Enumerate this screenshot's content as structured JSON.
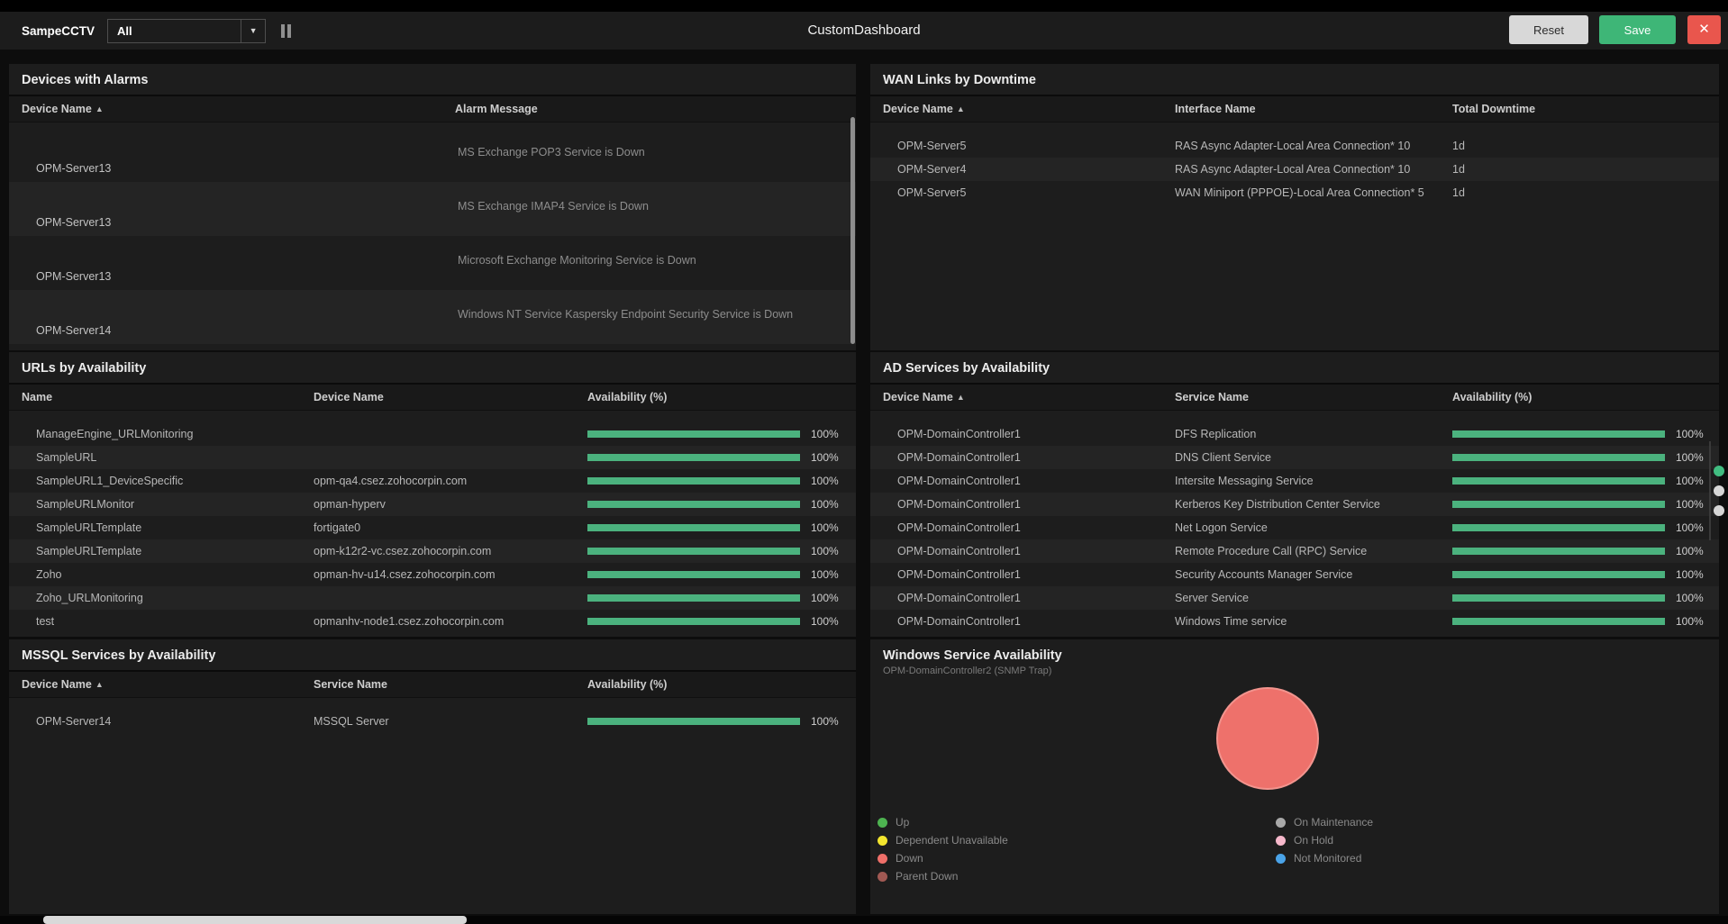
{
  "topbar": {
    "dashboard_name": "SampeCCTV",
    "filter_value": "All",
    "title": "CustomDashboard",
    "reset_label": "Reset",
    "save_label": "Save"
  },
  "icons": {
    "close": "✕",
    "dropdown_arrow": "▼",
    "sort_asc": "▲",
    "pause": "pause-icon"
  },
  "colors": {
    "availability_bar": "#4bb27e",
    "save_button": "#3eb677",
    "close_button": "#e9564d",
    "reset_button": "#d8d8d8",
    "pie_down": "#ee716b",
    "page_dot_active": "#41bd81",
    "page_dot_inactive": "#d6d6d6"
  },
  "panels": {
    "devices_with_alarms": {
      "title": "Devices with Alarms",
      "columns": [
        "Device Name",
        "Alarm Message"
      ],
      "rows": [
        {
          "device": "OPM-Server13",
          "message": "MS Exchange POP3 Service is Down"
        },
        {
          "device": "OPM-Server13",
          "message": "MS Exchange IMAP4 Service is Down"
        },
        {
          "device": "OPM-Server13",
          "message": "Microsoft Exchange Monitoring Service is Down"
        },
        {
          "device": "OPM-Server14",
          "message": "Windows NT Service Kaspersky Endpoint Security Service is Down"
        }
      ]
    },
    "wan_links": {
      "title": "WAN Links by Downtime",
      "columns": [
        "Device Name",
        "Interface Name",
        "Total Downtime"
      ],
      "rows": [
        {
          "device": "OPM-Server5",
          "interface": "RAS Async Adapter-Local Area Connection* 10",
          "downtime": "1d"
        },
        {
          "device": "OPM-Server4",
          "interface": "RAS Async Adapter-Local Area Connection* 10",
          "downtime": "1d"
        },
        {
          "device": "OPM-Server5",
          "interface": "WAN Miniport (PPPOE)-Local Area Connection* 5",
          "downtime": "1d"
        }
      ]
    },
    "urls": {
      "title": "URLs by Availability",
      "columns": [
        "Name",
        "Device Name",
        "Availability (%)"
      ],
      "rows": [
        {
          "name": "ManageEngine_URLMonitoring",
          "device": "",
          "availability": "100%"
        },
        {
          "name": "SampleURL",
          "device": "",
          "availability": "100%"
        },
        {
          "name": "SampleURL1_DeviceSpecific",
          "device": "opm-qa4.csez.zohocorpin.com",
          "availability": "100%"
        },
        {
          "name": "SampleURLMonitor",
          "device": "opman-hyperv",
          "availability": "100%"
        },
        {
          "name": "SampleURLTemplate",
          "device": "fortigate0",
          "availability": "100%"
        },
        {
          "name": "SampleURLTemplate",
          "device": "opm-k12r2-vc.csez.zohocorpin.com",
          "availability": "100%"
        },
        {
          "name": "Zoho",
          "device": "opman-hv-u14.csez.zohocorpin.com",
          "availability": "100%"
        },
        {
          "name": "Zoho_URLMonitoring",
          "device": "",
          "availability": "100%"
        },
        {
          "name": "test",
          "device": "opmanhv-node1.csez.zohocorpin.com",
          "availability": "100%"
        }
      ]
    },
    "ad_services": {
      "title": "AD Services by Availability",
      "columns": [
        "Device Name",
        "Service Name",
        "Availability (%)"
      ],
      "rows": [
        {
          "device": "OPM-DomainController1",
          "service": "DFS Replication",
          "availability": "100%"
        },
        {
          "device": "OPM-DomainController1",
          "service": "DNS Client Service",
          "availability": "100%"
        },
        {
          "device": "OPM-DomainController1",
          "service": "Intersite Messaging Service",
          "availability": "100%"
        },
        {
          "device": "OPM-DomainController1",
          "service": "Kerberos Key Distribution Center Service",
          "availability": "100%"
        },
        {
          "device": "OPM-DomainController1",
          "service": "Net Logon Service",
          "availability": "100%"
        },
        {
          "device": "OPM-DomainController1",
          "service": "Remote Procedure Call (RPC) Service",
          "availability": "100%"
        },
        {
          "device": "OPM-DomainController1",
          "service": "Security Accounts Manager Service",
          "availability": "100%"
        },
        {
          "device": "OPM-DomainController1",
          "service": "Server Service",
          "availability": "100%"
        },
        {
          "device": "OPM-DomainController1",
          "service": "Windows Time service",
          "availability": "100%"
        }
      ]
    },
    "mssql_services": {
      "title": "MSSQL Services by Availability",
      "columns": [
        "Device Name",
        "Service Name",
        "Availability (%)"
      ],
      "rows": [
        {
          "device": "OPM-Server14",
          "service": "MSSQL Server",
          "availability": "100%"
        }
      ]
    },
    "windows_service": {
      "title": "Windows Service Availability",
      "subtitle": "OPM-DomainController2 (SNMP Trap)",
      "legend": [
        {
          "label": "Up",
          "color": "#4db350",
          "col": "left"
        },
        {
          "label": "Dependent Unavailable",
          "color": "#f3e52e",
          "col": "left"
        },
        {
          "label": "Down",
          "color": "#ef6f69",
          "col": "left"
        },
        {
          "label": "Parent Down",
          "color": "#a15953",
          "col": "left"
        },
        {
          "label": "On Maintenance",
          "color": "#a8a8a8",
          "col": "right"
        },
        {
          "label": "On Hold",
          "color": "#f6b8cb",
          "col": "right"
        },
        {
          "label": "Not Monitored",
          "color": "#4aa3e8",
          "col": "right"
        }
      ]
    }
  },
  "chart_data": {
    "type": "pie",
    "title": "Windows Service Availability",
    "subtitle": "OPM-DomainController2 (SNMP Trap)",
    "slices": [
      {
        "label": "Down",
        "value": 100,
        "color": "#ee716b"
      }
    ],
    "legend_entries": [
      "Up",
      "Dependent Unavailable",
      "Down",
      "Parent Down",
      "On Maintenance",
      "On Hold",
      "Not Monitored"
    ],
    "legend_position": "bottom"
  }
}
